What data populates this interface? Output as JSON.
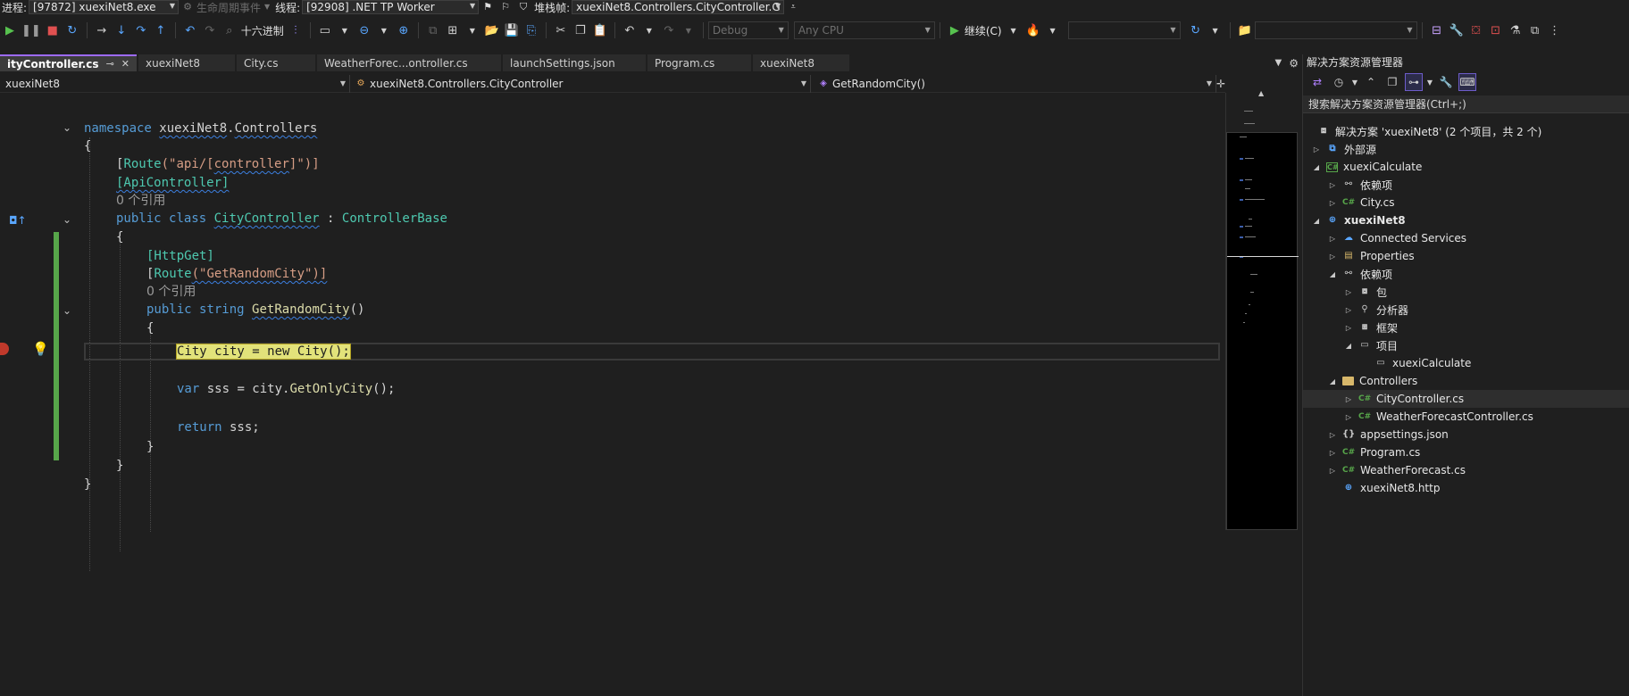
{
  "debugbar": {
    "process_label": "进程:",
    "process_value": "[97872] xuexiNet8.exe",
    "lifecycle_label": "生命周期事件",
    "thread_label": "线程:",
    "thread_value": "[92908] .NET TP Worker",
    "stackframe_label": "堆栈帧:",
    "stackframe_value": "xuexiNet8.Controllers.CityController.G"
  },
  "toolbar": {
    "hex_label": "十六进制",
    "config_value": "Debug",
    "platform_value": "Any CPU",
    "continue_label": "继续(C)"
  },
  "tabs": [
    {
      "label": "ityController.cs",
      "active": true
    },
    {
      "label": "xuexiNet8"
    },
    {
      "label": "City.cs"
    },
    {
      "label": "WeatherForec...ontroller.cs"
    },
    {
      "label": "launchSettings.json"
    },
    {
      "label": "Program.cs"
    },
    {
      "label": "xuexiNet8"
    }
  ],
  "navbar": {
    "project": "xuexiNet8",
    "class": "xuexiNet8.Controllers.CityController",
    "member": "GetRandomCity()"
  },
  "code": {
    "l_namespace_kw": "namespace",
    "l_namespace_name1": "xuexiNet8",
    "l_namespace_name2": "Controllers",
    "brace_open": "{",
    "brace_close": "}",
    "route1_pre": "[",
    "route1_attr": "Route",
    "route1_str1": "(\"api/[",
    "route1_str2": "controller",
    "route1_str3": "]\")]",
    "apicontroller": "[ApiController]",
    "refs_label": "0 个引用",
    "class_public": "public",
    "class_kw": "class",
    "class_name": "CityController",
    "class_colon": " : ",
    "class_base": "ControllerBase",
    "httpget": "[HttpGet]",
    "route2_pre": "[",
    "route2_attr": "Route",
    "route2_str": "(\"GetRandomCity\")]",
    "method_public": "public",
    "method_string": "string",
    "method_name": "GetRandomCity",
    "method_parens": "()",
    "current_stmt": "City city = new City();",
    "var_kw": "var",
    "var_rest1": " sss = city.",
    "var_method": "GetOnlyCity",
    "var_rest2": "();",
    "return_kw": "return",
    "return_rest": " sss;"
  },
  "solution_explorer": {
    "title": "解决方案资源管理器",
    "search_placeholder": "搜索解决方案资源管理器(Ctrl+;)",
    "nodes": [
      {
        "label": "解决方案 'xuexiNet8' (2 个项目，共 2 个)",
        "icon": "solution"
      },
      {
        "label": "外部源",
        "icon": "external"
      },
      {
        "label": "xuexiCalculate",
        "icon": "csproj"
      },
      {
        "label": "依赖项",
        "icon": "ref"
      },
      {
        "label": "City.cs",
        "icon": "cs"
      },
      {
        "label": "xuexiNet8",
        "icon": "webproj"
      },
      {
        "label": "Connected Services",
        "icon": "connected"
      },
      {
        "label": "Properties",
        "icon": "props"
      },
      {
        "label": "依赖项",
        "icon": "ref"
      },
      {
        "label": "包",
        "icon": "package"
      },
      {
        "label": "分析器",
        "icon": "analyzer"
      },
      {
        "label": "框架",
        "icon": "framework"
      },
      {
        "label": "项目",
        "icon": "projects"
      },
      {
        "label": "xuexiCalculate",
        "icon": "projref"
      },
      {
        "label": "Controllers",
        "icon": "folder"
      },
      {
        "label": "CityController.cs",
        "icon": "cs"
      },
      {
        "label": "WeatherForecastController.cs",
        "icon": "cs"
      },
      {
        "label": "appsettings.json",
        "icon": "json"
      },
      {
        "label": "Program.cs",
        "icon": "cs"
      },
      {
        "label": "WeatherForecast.cs",
        "icon": "cs"
      },
      {
        "label": "xuexiNet8.http",
        "icon": "http"
      }
    ]
  },
  "colors": {
    "accent": "#9d6bff",
    "background": "#1f1f1f",
    "changebar": "#57a64a",
    "current_statement": "#e2e27a"
  }
}
